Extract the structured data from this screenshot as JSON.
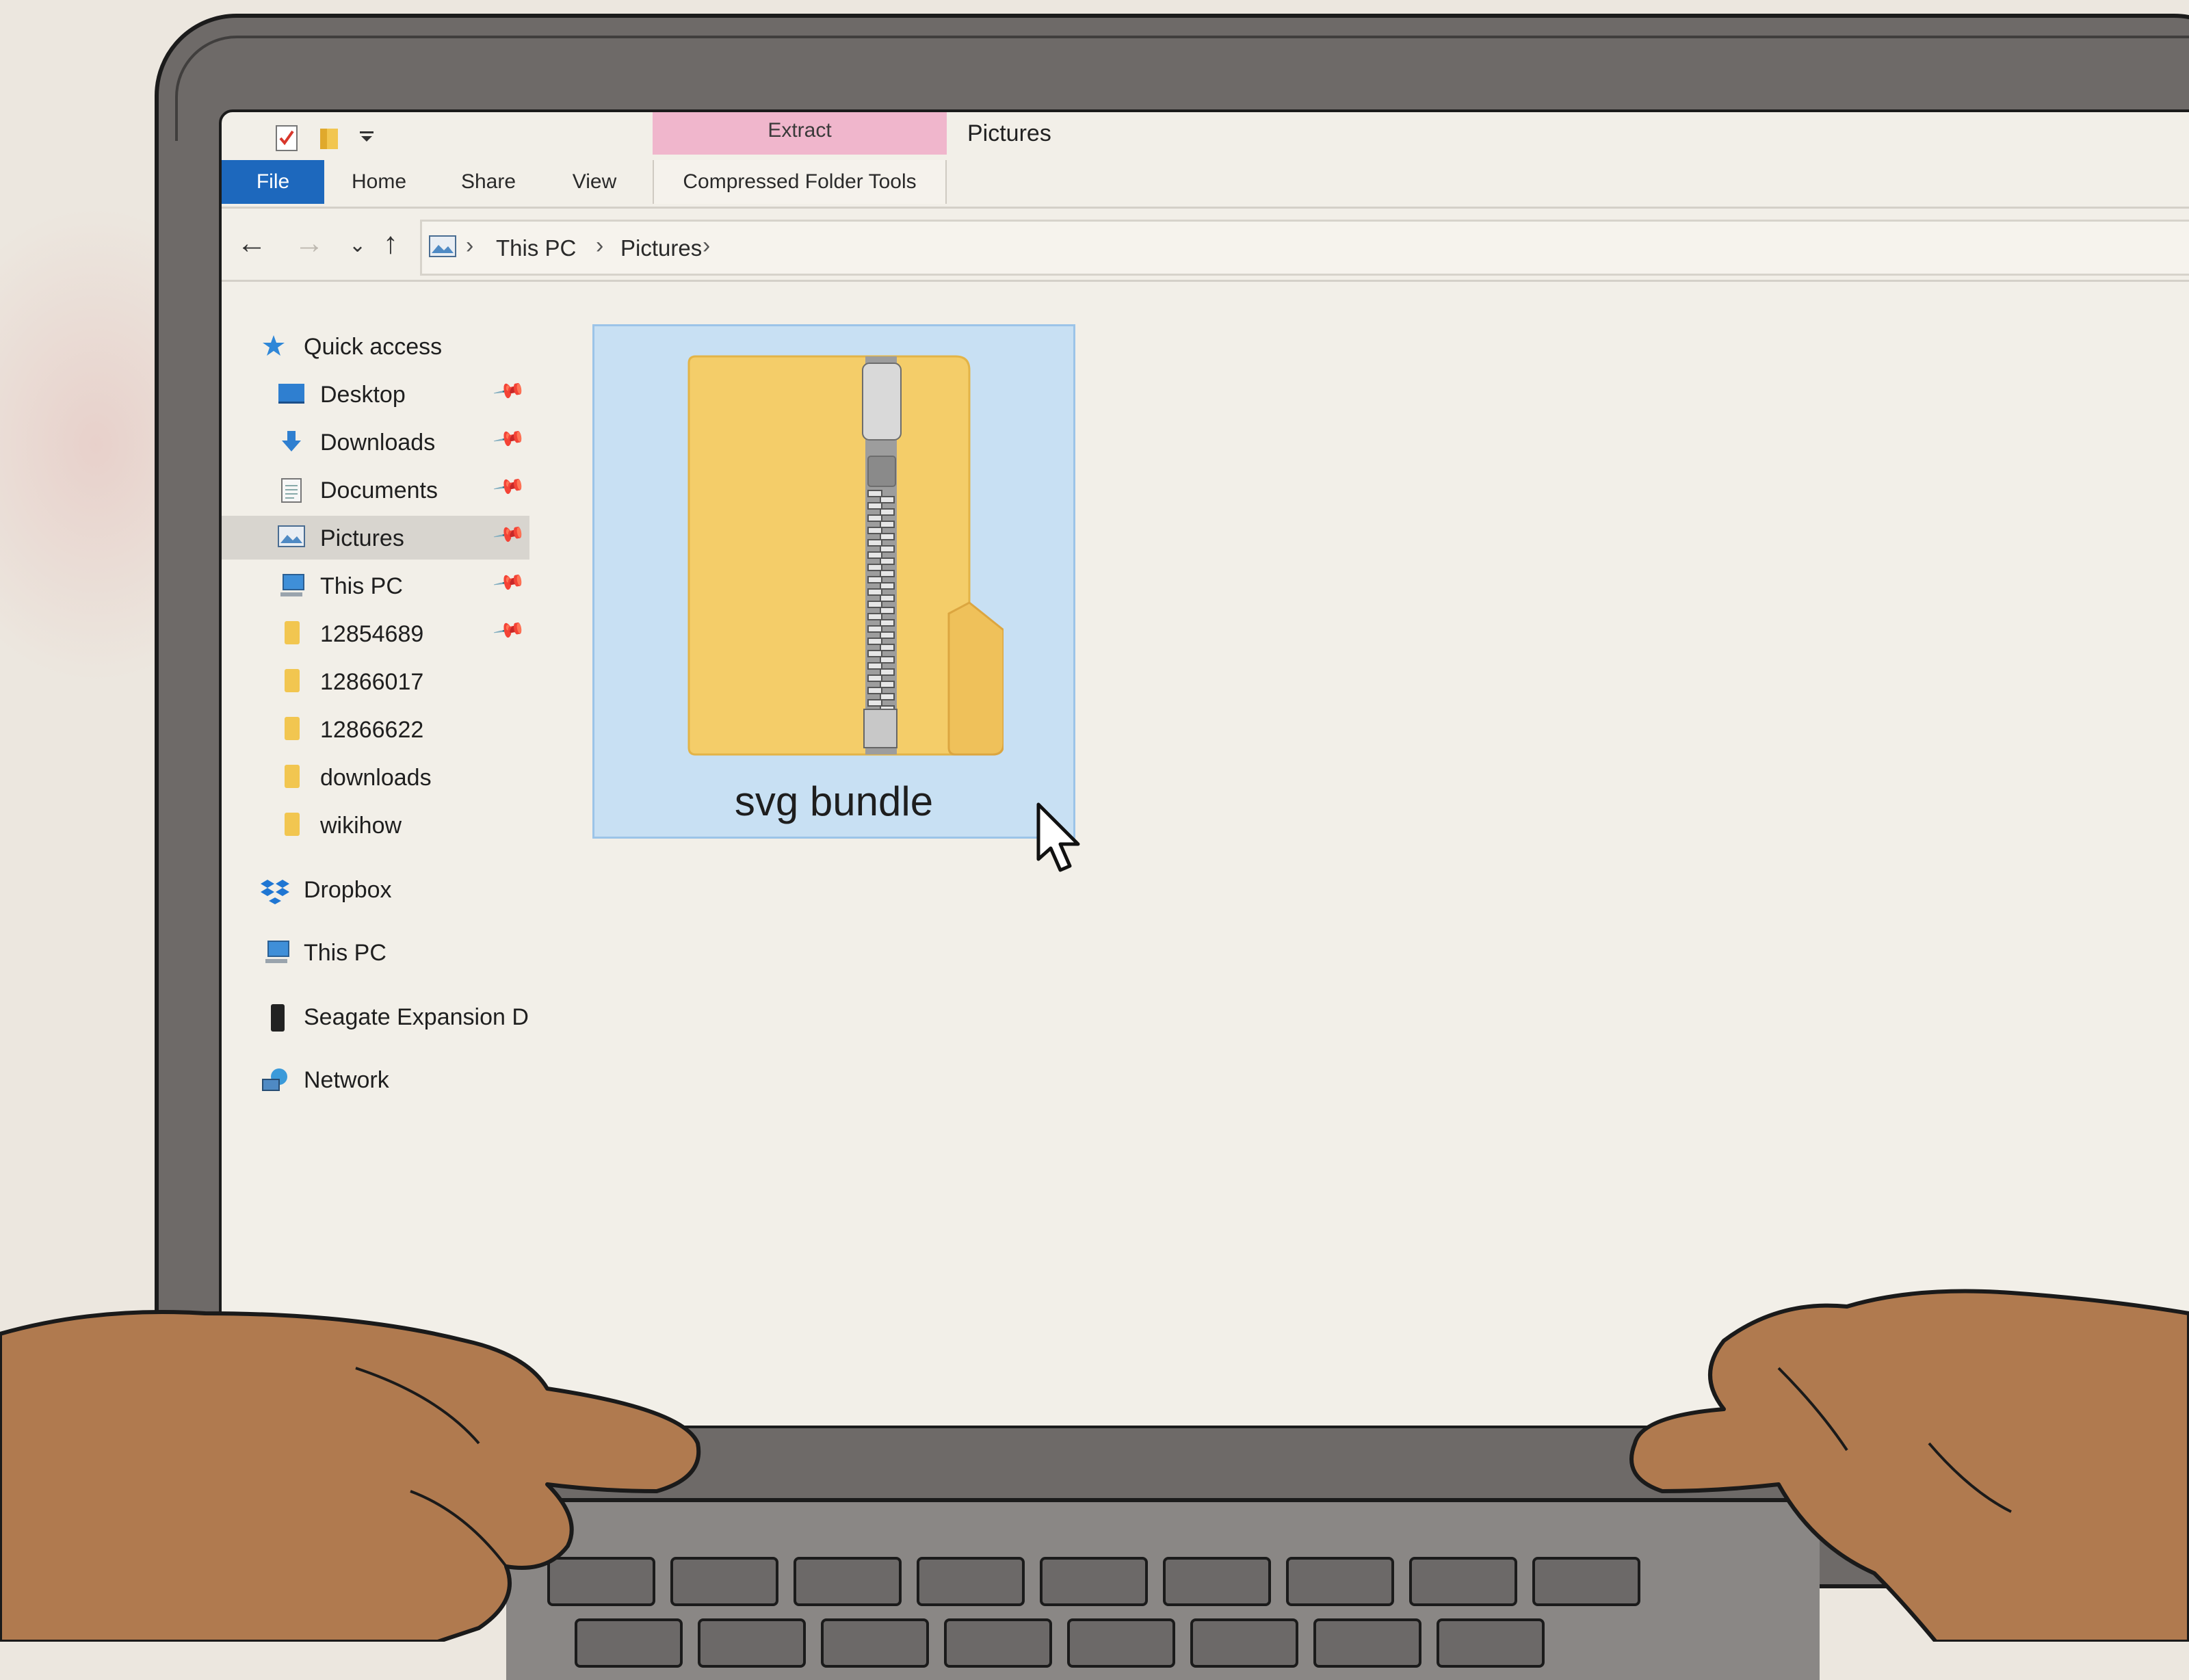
{
  "window": {
    "title": "Pictures",
    "context_tab_group": "Extract"
  },
  "ribbon": {
    "tabs": [
      {
        "label": "File"
      },
      {
        "label": "Home"
      },
      {
        "label": "Share"
      },
      {
        "label": "View"
      },
      {
        "label": "Compressed Folder Tools"
      }
    ]
  },
  "address": {
    "crumbs": [
      "This PC",
      "Pictures"
    ]
  },
  "navigation_pane": {
    "quick_access": {
      "label": "Quick access",
      "icon": "star-icon"
    },
    "items": [
      {
        "label": "Desktop",
        "icon": "desktop-icon",
        "pinned": true
      },
      {
        "label": "Downloads",
        "icon": "download-arrow-icon",
        "pinned": true
      },
      {
        "label": "Documents",
        "icon": "document-icon",
        "pinned": true
      },
      {
        "label": "Pictures",
        "icon": "pictures-icon",
        "pinned": true,
        "selected": true
      },
      {
        "label": "This PC",
        "icon": "computer-icon",
        "pinned": true
      },
      {
        "label": "12854689",
        "icon": "folder-icon",
        "pinned": true
      },
      {
        "label": "12866017",
        "icon": "folder-icon",
        "pinned": false
      },
      {
        "label": "12866622",
        "icon": "folder-icon",
        "pinned": false
      },
      {
        "label": "downloads",
        "icon": "folder-icon",
        "pinned": false
      },
      {
        "label": "wikihow",
        "icon": "folder-icon",
        "pinned": false
      }
    ],
    "roots": [
      {
        "label": "Dropbox",
        "icon": "dropbox-icon"
      },
      {
        "label": "This PC",
        "icon": "computer-icon"
      },
      {
        "label": "Seagate Expansion Dr",
        "icon": "drive-icon"
      },
      {
        "label": "Network",
        "icon": "network-icon"
      }
    ]
  },
  "content": {
    "files": [
      {
        "name": "svg bundle",
        "icon": "zip-folder-icon",
        "selected": true
      }
    ]
  },
  "colors": {
    "file_tab": "#1d68bd",
    "extract_band": "#f0b6cc",
    "selection": "#c8e0f3",
    "folder": "#f2c650",
    "skin": "#b07a4f"
  }
}
